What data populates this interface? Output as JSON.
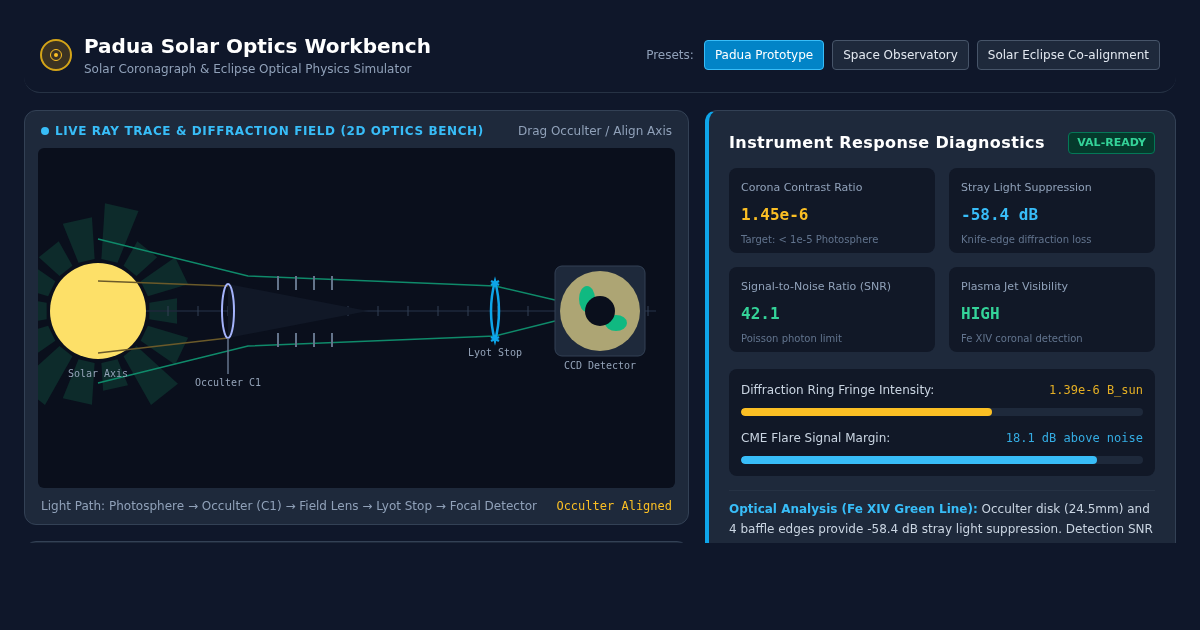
{
  "header": {
    "title": "Padua Solar Optics Workbench",
    "subtitle": "Solar Coronagraph & Eclipse Optical Physics Simulator",
    "presets_label": "Presets:",
    "presets": [
      {
        "label": "Padua Prototype",
        "selected": true
      },
      {
        "label": "Space Observatory",
        "selected": false
      },
      {
        "label": "Solar Eclipse Co-alignment",
        "selected": false
      }
    ]
  },
  "bench": {
    "title": "LIVE RAY TRACE & DIFFRACTION FIELD (2D OPTICS BENCH)",
    "hint": "Drag Occulter / Align Axis",
    "labels": {
      "sun": "Solar Axis",
      "occulter": "Occulter C1",
      "lyot": "Lyot Stop",
      "detector": "CCD Detector"
    },
    "light_path": "Light Path: Photosphere → Occulter (C1) → Field Lens → Lyot Stop → Focal Detector",
    "status": "Occulter Aligned"
  },
  "diagnostics": {
    "title": "Instrument Response Diagnostics",
    "badge": "VAL-READY",
    "metrics": [
      {
        "label": "Corona Contrast Ratio",
        "value": "1.45e-6",
        "note": "Target: < 1e-5 Photosphere",
        "color": "#fbbf24"
      },
      {
        "label": "Stray Light Suppression",
        "value": "-58.4 dB",
        "note": "Knife-edge diffraction loss",
        "color": "#38bdf8"
      },
      {
        "label": "Signal-to-Noise Ratio (SNR)",
        "value": "42.1",
        "note": "Poisson photon limit",
        "color": "#34d399"
      },
      {
        "label": "Plasma Jet Visibility",
        "value": "HIGH",
        "note": "Fe XIV coronal detection",
        "color": "#34d399"
      }
    ],
    "bars": [
      {
        "label": "Diffraction Ring Fringe Intensity:",
        "reading": "1.39e-6 B_sun",
        "level": 0.625,
        "color": "#fbbf24"
      },
      {
        "label": "CME Flare Signal Margin:",
        "reading": "18.1 dB above noise",
        "level": 0.885,
        "color": "#38bdf8"
      }
    ],
    "analysis": "**Optical Analysis (Fe XIV Green Line):** Occulter disk (24.5mm) and 4 baffle edges provide -58.4 dB stray light suppression. Detection SNR"
  }
}
